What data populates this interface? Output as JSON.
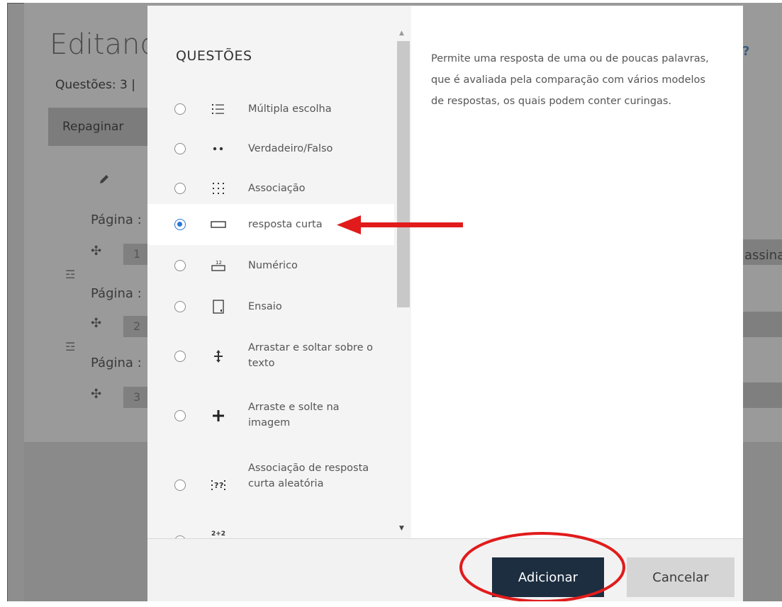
{
  "background": {
    "page_title": "Editand",
    "questions_count": "Questões: 3 |",
    "repaginate_button": "Repaginar",
    "page_labels": [
      "Página :",
      "Página :",
      "Página :"
    ],
    "slot_numbers": [
      "1",
      "2",
      "3"
    ],
    "right_text": "assina"
  },
  "modal": {
    "heading": "QUESTÕES",
    "options": [
      {
        "label": "Múltipla escolha",
        "icon": "list-icon",
        "selected": false
      },
      {
        "label": "Verdadeiro/Falso",
        "icon": "two-dots-icon",
        "selected": false
      },
      {
        "label": "Associação",
        "icon": "matching-grid-icon",
        "selected": false
      },
      {
        "label": "resposta curta",
        "icon": "short-answer-box-icon",
        "selected": true
      },
      {
        "label": "Numérico",
        "icon": "numerical-icon",
        "selected": false
      },
      {
        "label": "Ensaio",
        "icon": "essay-icon",
        "selected": false
      },
      {
        "label": "Arrastar e soltar sobre o texto",
        "icon": "drag-text-icon",
        "selected": false
      },
      {
        "label": "Arraste e solte na imagem",
        "icon": "drag-image-icon",
        "selected": false
      },
      {
        "label": "Associação de resposta curta aleatória",
        "icon": "random-match-icon",
        "selected": false
      }
    ],
    "partial_option_icon": "2+2",
    "description": "Permite uma resposta de uma ou de poucas palavras, que é avaliada pela comparação com vários modelos de respostas, os quais podem conter curingas.",
    "add_button": "Adicionar",
    "cancel_button": "Cancelar"
  },
  "colors": {
    "primary_button": "#1c2e40",
    "radio_checked": "#2a76d2",
    "annotation": "#e11b1b"
  }
}
